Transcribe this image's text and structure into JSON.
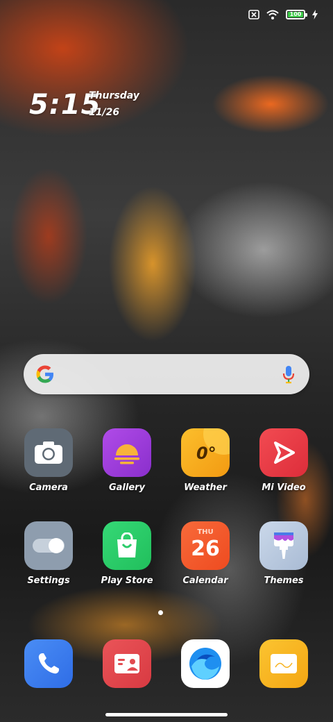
{
  "status_bar": {
    "sim_icon": "no-sim-icon",
    "wifi_icon": "wifi-icon",
    "battery_level": "100",
    "charging_icon": "charging-bolt-icon"
  },
  "lock_widget": {
    "time": "5:15",
    "day": "Thursday",
    "date": "11/26"
  },
  "search": {
    "logo": "google-g-icon",
    "mic": "microphone-icon"
  },
  "apps": {
    "camera": {
      "label": "Camera",
      "color": "#5f6a75"
    },
    "gallery": {
      "label": "Gallery",
      "color": "#9b3dd6"
    },
    "weather": {
      "label": "Weather",
      "color": "#f8b21f",
      "temp": "0°"
    },
    "mivideo": {
      "label": "Mi Video",
      "color": "#ea3b48"
    },
    "settings": {
      "label": "Settings",
      "color": "#8e9dae"
    },
    "playstore": {
      "label": "Play Store",
      "color": "#2bcc6a"
    },
    "calendar": {
      "label": "Calendar",
      "color": "#f3592d",
      "day": "THU",
      "date": "26"
    },
    "themes": {
      "label": "Themes",
      "color": "#b7c8df"
    }
  },
  "dock": {
    "phone": {
      "color": "#3a7ef0"
    },
    "contacts": {
      "color": "#e24a4f"
    },
    "browser": {
      "color": "#ffffff"
    },
    "notes": {
      "color": "#f7b321"
    }
  }
}
